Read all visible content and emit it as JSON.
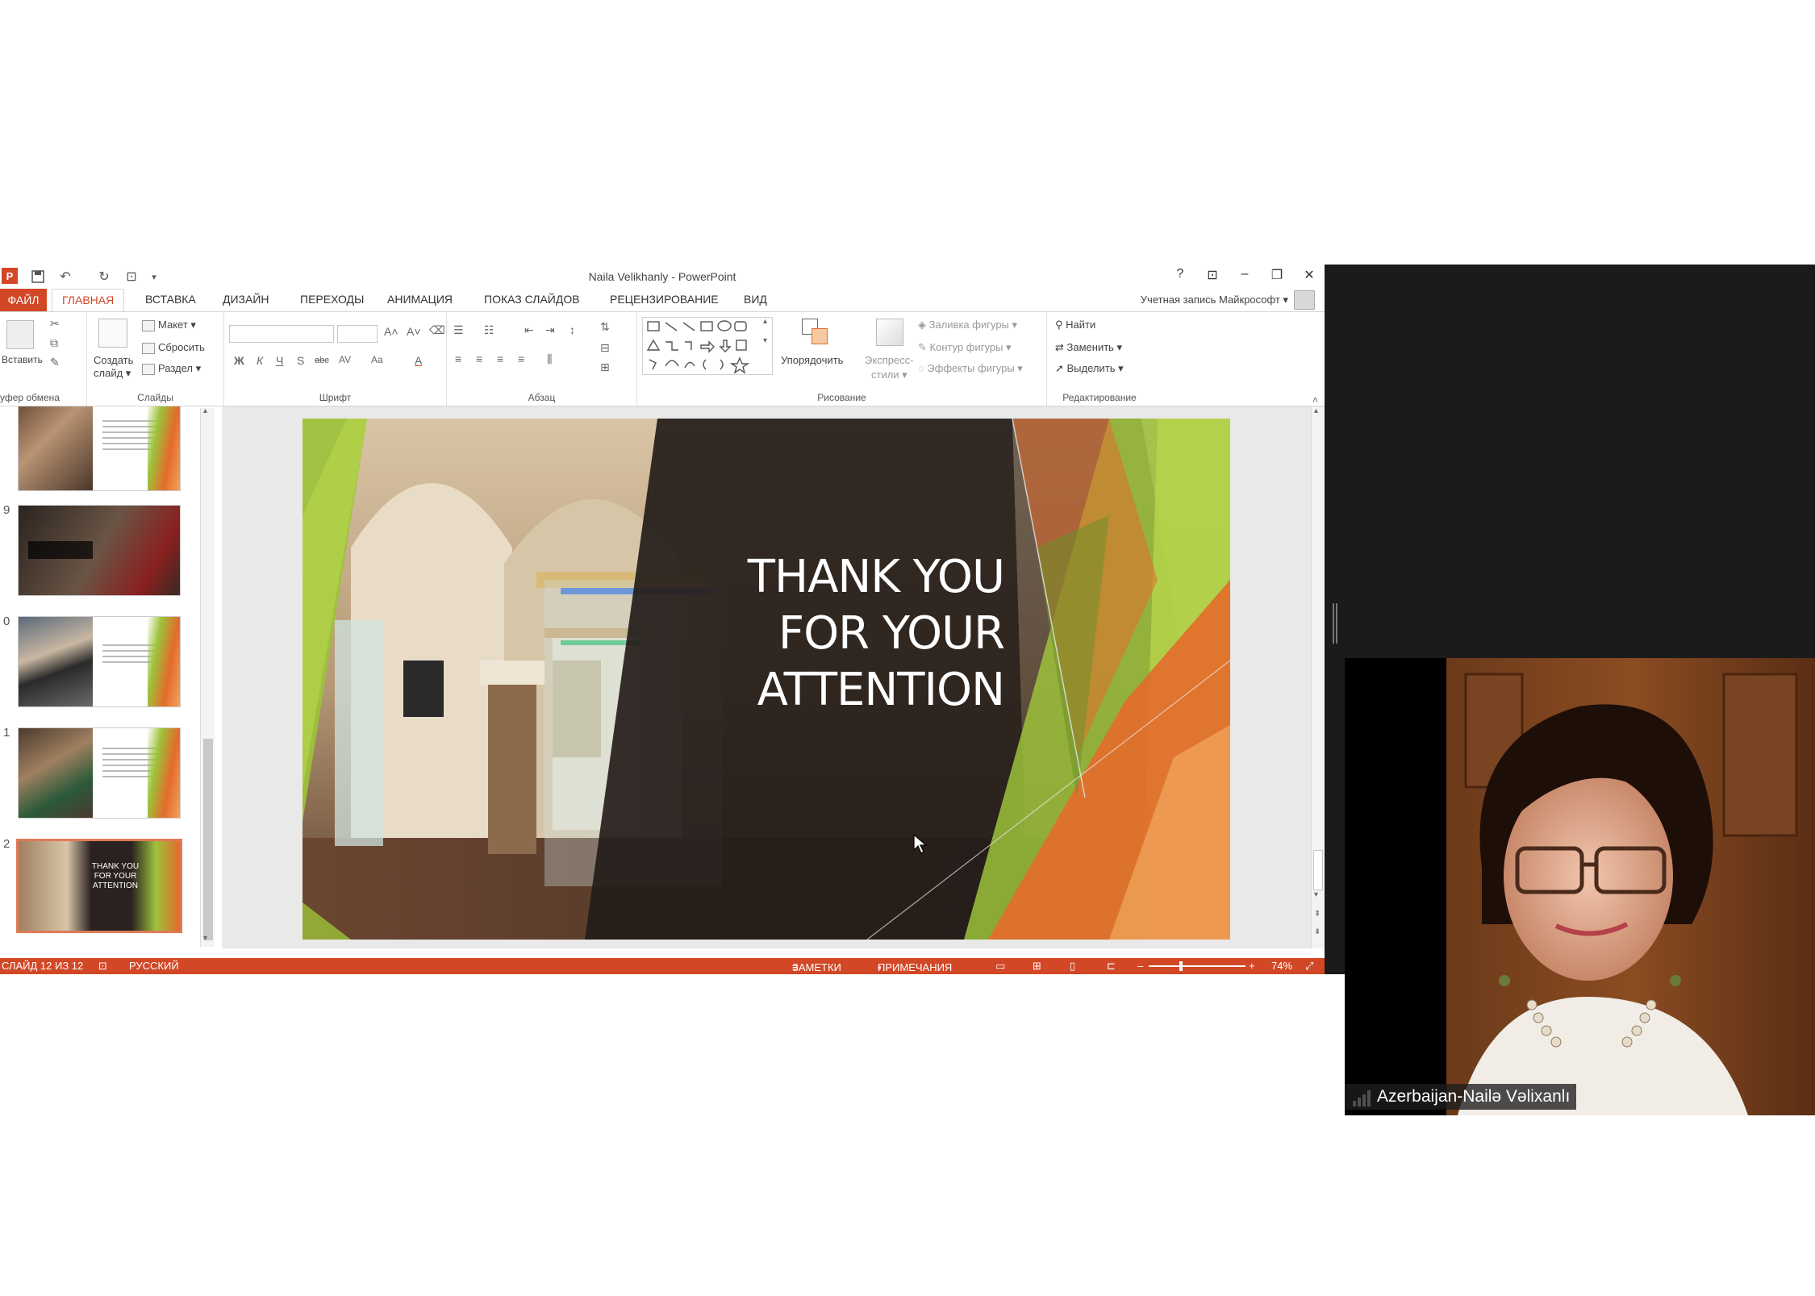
{
  "window": {
    "title": "Naila Velikhanly - PowerPoint",
    "help": "?",
    "restore_ribbon": "⊡",
    "minimize": "–",
    "restore": "❐",
    "close": "✕"
  },
  "quick_access": {
    "app_icon": "powerpoint-icon",
    "save": "save-icon",
    "undo": "undo-icon",
    "redo": "redo-icon",
    "present": "present-icon",
    "customize": "▾"
  },
  "tabs": {
    "file": "ФАЙЛ",
    "home": "ГЛАВНАЯ",
    "insert": "ВСТАВКА",
    "design": "ДИЗАЙН",
    "transitions": "ПЕРЕХОДЫ",
    "animation": "АНИМАЦИЯ",
    "slideshow": "ПОКАЗ СЛАЙДОВ",
    "review": "РЕЦЕНЗИРОВАНИЕ",
    "view": "ВИД",
    "account": "Учетная запись Майкрософт ▾"
  },
  "ribbon": {
    "clipboard": {
      "paste": "Вставить",
      "label": "уфер обмена"
    },
    "slides": {
      "new_slide": "Создать",
      "new_slide2": "слайд ▾",
      "layout": "Макет ▾",
      "reset": "Сбросить",
      "section": "Раздел ▾",
      "label": "Слайды"
    },
    "font": {
      "bold": "Ж",
      "italic": "К",
      "underline": "Ч",
      "shadow": "S",
      "strike": "abc",
      "spacing": "AV",
      "case": "Aa",
      "color": "A",
      "grow": "A˄",
      "shrink": "A˅",
      "label": "Шрифт"
    },
    "paragraph": {
      "label": "Абзац"
    },
    "drawing": {
      "arrange": "Упорядочить",
      "quick_styles": "Экспресс-",
      "quick_styles2": "стили ▾",
      "fill": "Заливка фигуры ▾",
      "outline": "Контур фигуры ▾",
      "effects": "Эффекты фигуры ▾",
      "label": "Рисование"
    },
    "editing": {
      "find": "Найти",
      "replace": "Заменить ▾",
      "select": "Выделить ▾",
      "label": "Редактирование"
    }
  },
  "thumbnails": [
    {
      "num": "",
      "type": "photo-left"
    },
    {
      "num": "9",
      "type": "photo-full"
    },
    {
      "num": "0",
      "type": "photo-left"
    },
    {
      "num": "1",
      "type": "photo-left"
    },
    {
      "num": "2",
      "type": "thanks",
      "title": "THANK YOU FOR YOUR ATTENTION"
    }
  ],
  "slide": {
    "line1": "THANK YOU",
    "line2": "FOR YOUR",
    "line3": "ATTENTION"
  },
  "status": {
    "slide_count": "СЛАЙД 12 ИЗ 12",
    "language": "РУССКИЙ",
    "notes": "ЗАМЕТКИ",
    "comments": "ПРИМЕЧАНИЯ",
    "zoom": "74%",
    "zoom_minus": "–",
    "zoom_plus": "+"
  },
  "video": {
    "participant_name": "Azerbaijan-Nailə Vəlixanlı"
  },
  "colors": {
    "accent_orange": "#d24726",
    "slide_green": "#9cc23b",
    "slide_orange": "#e46b2b"
  }
}
